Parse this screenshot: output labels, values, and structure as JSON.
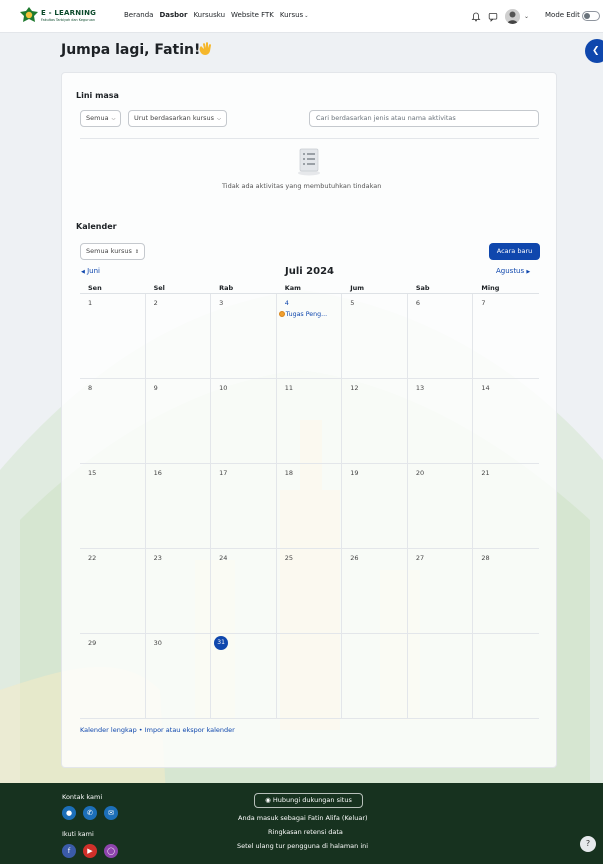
{
  "brand": {
    "title": "E - LEARNING",
    "subtitle": "Fakultas Tarbiyah dan Keguruan"
  },
  "nav": {
    "items": [
      "Beranda",
      "Dasbor",
      "Kursusku",
      "Website FTK",
      "Kursus"
    ],
    "active": "Dasbor",
    "mode_edit_label": "Mode Edit",
    "mode_edit_on": false
  },
  "greeting": "Jumpa lagi, Fatin!",
  "timeline": {
    "title": "Lini masa",
    "filter_label": "Semua",
    "sort_label": "Urut berdasarkan kursus",
    "search_placeholder": "Cari berdasarkan jenis atau nama aktivitas",
    "empty_text": "Tidak ada aktivitas yang membutuhkan tindakan"
  },
  "calendar": {
    "title": "Kalender",
    "course_filter": "Semua kursus",
    "new_event_label": "Acara baru",
    "prev_month": "Juni",
    "next_month": "Agustus",
    "month_title": "Juli 2024",
    "weekdays": [
      "Sen",
      "Sel",
      "Rab",
      "Kam",
      "Jum",
      "Sab",
      "Ming"
    ],
    "weeks": [
      [
        "1",
        "2",
        "3",
        "4",
        "5",
        "6",
        "7"
      ],
      [
        "8",
        "9",
        "10",
        "11",
        "12",
        "13",
        "14"
      ],
      [
        "15",
        "16",
        "17",
        "18",
        "19",
        "20",
        "21"
      ],
      [
        "22",
        "23",
        "24",
        "25",
        "26",
        "27",
        "28"
      ],
      [
        "29",
        "30",
        "31",
        "",
        "",
        "",
        ""
      ]
    ],
    "today": "31",
    "event": {
      "day": "4",
      "label": "Tugas Peng..."
    },
    "footer_links": "Kalender lengkap • Impor atau ekspor kalender"
  },
  "footer": {
    "contact_title": "Kontak kami",
    "follow_title": "Ikuti kami",
    "support_button": "Hubungi dukungan situs",
    "logged_in_text": "Anda masuk sebagai Fatin Alifa (Keluar)",
    "retention_link": "Ringkasan retensi data",
    "reset_text": "Setel ulang tur pengguna di halaman ini",
    "help_label": "?"
  },
  "colors": {
    "primary": "#0f47ad",
    "footer_bg": "#17321f",
    "page_bg": "#eef1f4",
    "event_dot": "#f0a030"
  }
}
